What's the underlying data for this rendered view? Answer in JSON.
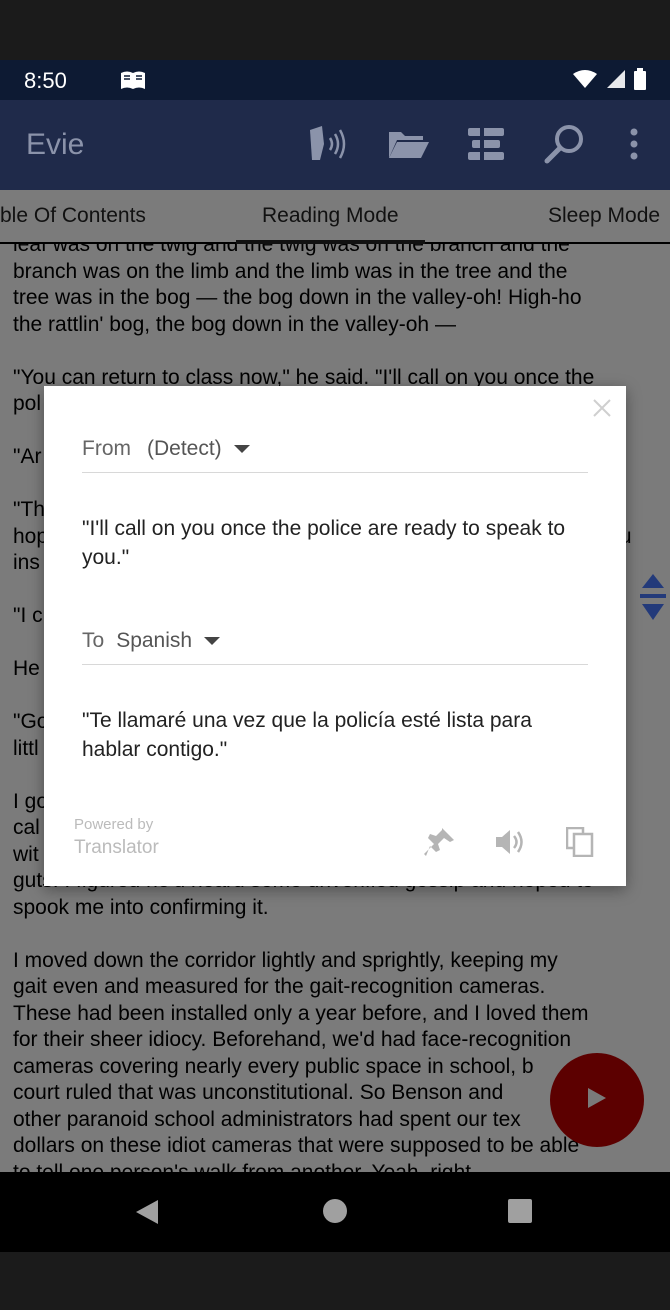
{
  "status_bar": {
    "time": "8:50",
    "book_icon": "open-book-icon",
    "wifi_icon": "wifi-icon",
    "signal_icon": "signal-icon",
    "battery_icon": "battery-icon"
  },
  "app_bar": {
    "title": "Evie",
    "actions": [
      "speak-icon",
      "folder-open-icon",
      "bookmarks-icon",
      "search-icon",
      "more-vert-icon"
    ]
  },
  "tabs": [
    {
      "label": "ble Of Contents",
      "active": false
    },
    {
      "label": "Reading Mode",
      "active": true
    },
    {
      "label": "Sleep Mode",
      "active": false
    }
  ],
  "reading": {
    "text": "leaf was on the twig and the twig was on the branch and the\nbranch was on the limb and the limb was in the tree and the\ntree was in the bog — the bog down in the valley-oh! High-ho\nthe rattlin' bog, the bog down in the valley-oh —\n\n\"You can return to class now,\" he said. \"I'll call on you once the\npol\n\n\"Ar\n\n\"Th\nhop                                                                                                  u\nins\n\n\"I c\n\nHe\n\n\"Go\nlittl\n\nI go\ncal\nwit                                                                                                  y\nguts. I figured he'd heard some unverified gossip and hoped to\nspook me into confirming it.\n\nI moved down the corridor lightly and sprightly, keeping my\ngait even and measured for the gait-recognition cameras.\nThese had been installed only a year before, and I loved them\nfor their sheer idiocy. Beforehand, we'd had face-recognition\ncameras covering nearly every public space in school, b\ncourt ruled that was unconstitutional. So Benson and\nother paranoid school administrators had spent our tex\ndollars on these idiot cameras that were supposed to be able\nto tell one person's walk from another. Yeah, right."
  },
  "dialog": {
    "from_label": "From",
    "from_value": "(Detect)",
    "source_text": "\"I'll call on you once the police are ready to speak to you.\"",
    "to_label": "To",
    "to_value": "Spanish",
    "translated_text": "\"Te llamaré una vez que la policía esté lista para hablar contigo.\"",
    "powered_by": "Powered by",
    "provider": "Translator",
    "actions": [
      "pin-icon",
      "volume-icon",
      "copy-icon"
    ],
    "close_icon": "close-icon"
  },
  "colors": {
    "accent": "#1f2a4a",
    "fab": "#5c0000",
    "dim_overlay": "#7b7b7b"
  }
}
